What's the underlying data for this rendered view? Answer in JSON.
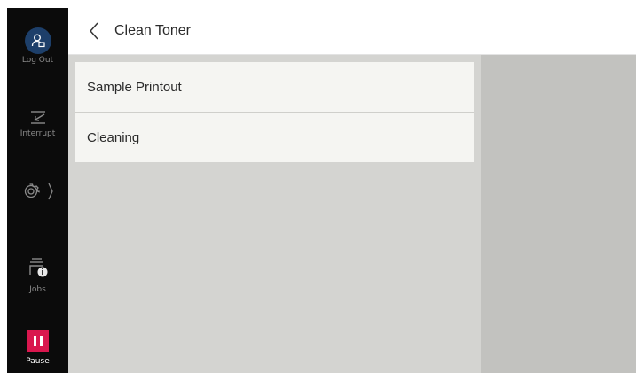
{
  "header": {
    "title": "Clean Toner",
    "back_icon": "chevron-left-icon"
  },
  "sidebar": {
    "logout": {
      "label": "Log Out",
      "icon": "user-logout-icon"
    },
    "interrupt": {
      "label": "Interrupt",
      "icon": "interrupt-icon"
    },
    "settings": {
      "label": "",
      "icon": "gear-icon"
    },
    "jobs": {
      "label": "Jobs",
      "icon": "jobs-icon"
    },
    "pause": {
      "label": "Pause",
      "icon": "pause-icon"
    }
  },
  "list": {
    "items": [
      {
        "label": "Sample Printout"
      },
      {
        "label": "Cleaning"
      }
    ]
  },
  "colors": {
    "sidebar_bg": "#0b0b0b",
    "logout_accent": "#1d3f6a",
    "pause_accent": "#d9174e",
    "content_bg": "#d4d4d1",
    "panel_bg": "#c2c2bf",
    "item_bg": "#f5f5f2"
  }
}
